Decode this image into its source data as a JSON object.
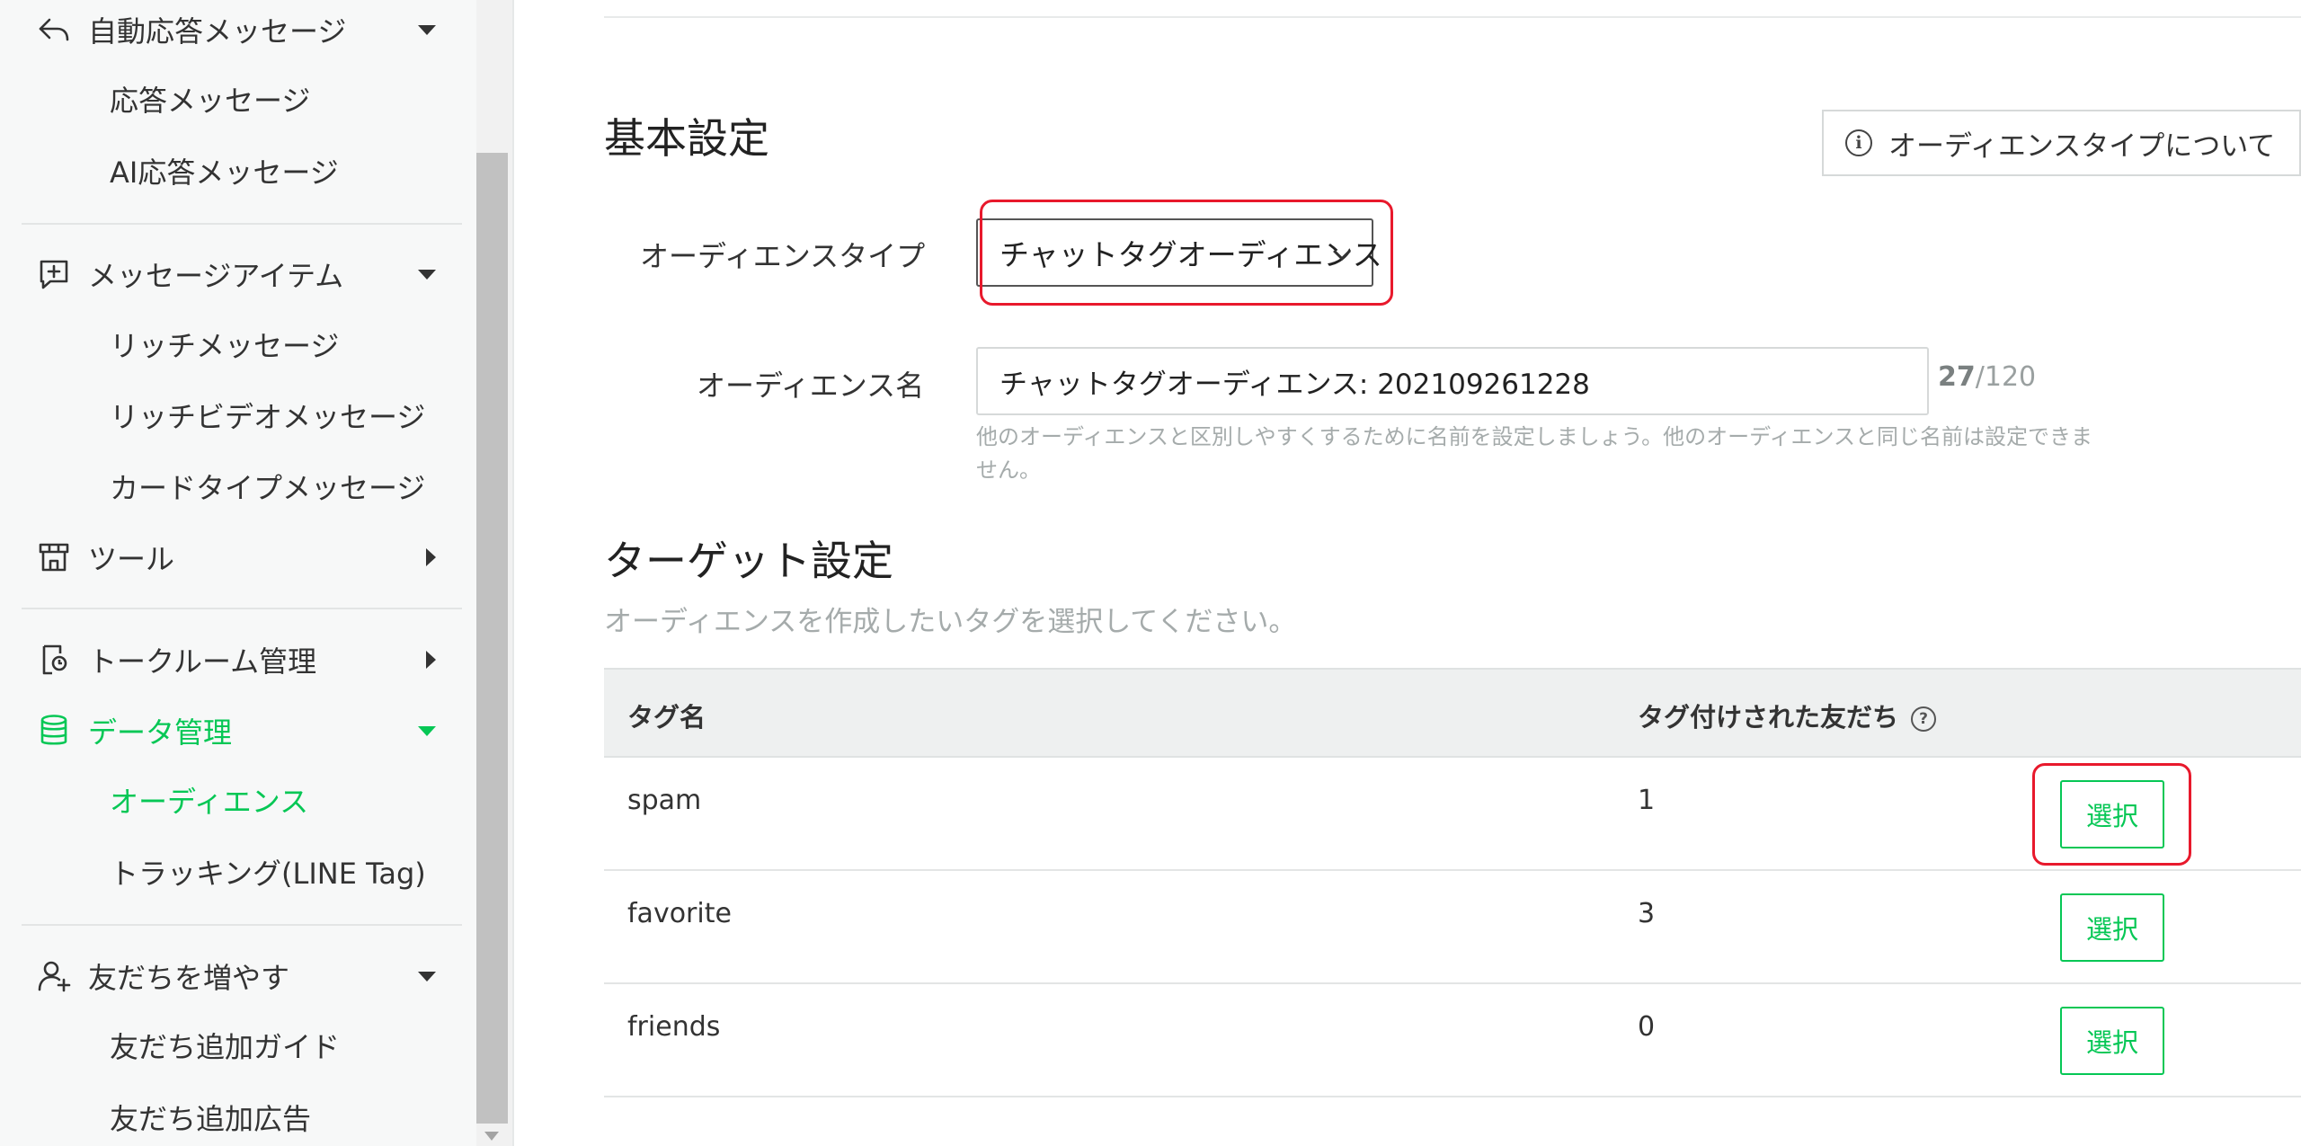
{
  "sidebar": {
    "auto_reply": {
      "label": "自動応答メッセージ",
      "icon": "reply-icon"
    },
    "auto_reply_items": [
      "応答メッセージ",
      "AI応答メッセージ"
    ],
    "message_items": {
      "label": "メッセージアイテム",
      "icon": "message-add-icon"
    },
    "message_items_list": [
      "リッチメッセージ",
      "リッチビデオメッセージ",
      "カードタイプメッセージ"
    ],
    "tools": {
      "label": "ツール",
      "icon": "store-icon"
    },
    "talk_room": {
      "label": "トークルーム管理",
      "icon": "talkroom-icon"
    },
    "data_mgmt": {
      "label": "データ管理",
      "icon": "database-icon"
    },
    "data_items": [
      "オーディエンス",
      "トラッキング(LINE Tag)"
    ],
    "friends": {
      "label": "友だちを増やす",
      "icon": "add-friend-icon"
    },
    "friends_items": [
      "友だち追加ガイド",
      "友だち追加広告"
    ]
  },
  "basic": {
    "title": "基本設定",
    "about_button": "オーディエンスタイプについて",
    "type_label": "オーディエンスタイプ",
    "type_value": "チャットタグオーディエンス",
    "name_label": "オーディエンス名",
    "name_value": "チャットタグオーディエンス: 202109261228",
    "count_current": "27",
    "count_max": "/120",
    "help_text": "他のオーディエンスと区別しやすくするために名前を設定しましょう。他のオーディエンスと同じ名前は設定できません。"
  },
  "target": {
    "title": "ターゲット設定",
    "subtitle": "オーディエンスを作成したいタグを選択してください。",
    "col_tag": "タグ名",
    "col_friends": "タグ付けされた友だち",
    "select_label": "選択",
    "rows": [
      {
        "tag": "spam",
        "count": "1"
      },
      {
        "tag": "favorite",
        "count": "3"
      },
      {
        "tag": "friends",
        "count": "0"
      }
    ]
  },
  "colors": {
    "accent": "#06c755",
    "highlight": "#e8192c"
  }
}
